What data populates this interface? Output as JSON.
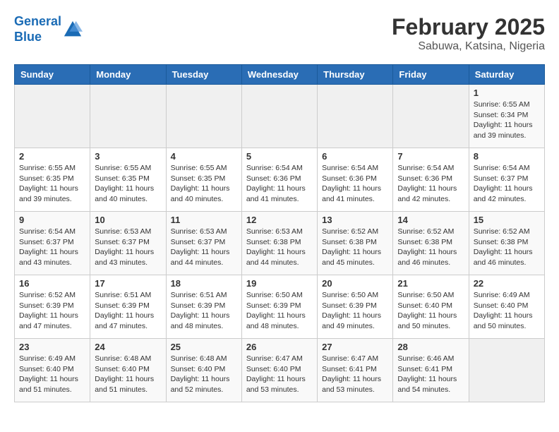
{
  "header": {
    "logo_line1": "General",
    "logo_line2": "Blue",
    "title": "February 2025",
    "subtitle": "Sabuwa, Katsina, Nigeria"
  },
  "weekdays": [
    "Sunday",
    "Monday",
    "Tuesday",
    "Wednesday",
    "Thursday",
    "Friday",
    "Saturday"
  ],
  "weeks": [
    [
      {
        "day": "",
        "info": ""
      },
      {
        "day": "",
        "info": ""
      },
      {
        "day": "",
        "info": ""
      },
      {
        "day": "",
        "info": ""
      },
      {
        "day": "",
        "info": ""
      },
      {
        "day": "",
        "info": ""
      },
      {
        "day": "1",
        "info": "Sunrise: 6:55 AM\nSunset: 6:34 PM\nDaylight: 11 hours\nand 39 minutes."
      }
    ],
    [
      {
        "day": "2",
        "info": "Sunrise: 6:55 AM\nSunset: 6:35 PM\nDaylight: 11 hours\nand 39 minutes."
      },
      {
        "day": "3",
        "info": "Sunrise: 6:55 AM\nSunset: 6:35 PM\nDaylight: 11 hours\nand 40 minutes."
      },
      {
        "day": "4",
        "info": "Sunrise: 6:55 AM\nSunset: 6:35 PM\nDaylight: 11 hours\nand 40 minutes."
      },
      {
        "day": "5",
        "info": "Sunrise: 6:54 AM\nSunset: 6:36 PM\nDaylight: 11 hours\nand 41 minutes."
      },
      {
        "day": "6",
        "info": "Sunrise: 6:54 AM\nSunset: 6:36 PM\nDaylight: 11 hours\nand 41 minutes."
      },
      {
        "day": "7",
        "info": "Sunrise: 6:54 AM\nSunset: 6:36 PM\nDaylight: 11 hours\nand 42 minutes."
      },
      {
        "day": "8",
        "info": "Sunrise: 6:54 AM\nSunset: 6:37 PM\nDaylight: 11 hours\nand 42 minutes."
      }
    ],
    [
      {
        "day": "9",
        "info": "Sunrise: 6:54 AM\nSunset: 6:37 PM\nDaylight: 11 hours\nand 43 minutes."
      },
      {
        "day": "10",
        "info": "Sunrise: 6:53 AM\nSunset: 6:37 PM\nDaylight: 11 hours\nand 43 minutes."
      },
      {
        "day": "11",
        "info": "Sunrise: 6:53 AM\nSunset: 6:37 PM\nDaylight: 11 hours\nand 44 minutes."
      },
      {
        "day": "12",
        "info": "Sunrise: 6:53 AM\nSunset: 6:38 PM\nDaylight: 11 hours\nand 44 minutes."
      },
      {
        "day": "13",
        "info": "Sunrise: 6:52 AM\nSunset: 6:38 PM\nDaylight: 11 hours\nand 45 minutes."
      },
      {
        "day": "14",
        "info": "Sunrise: 6:52 AM\nSunset: 6:38 PM\nDaylight: 11 hours\nand 46 minutes."
      },
      {
        "day": "15",
        "info": "Sunrise: 6:52 AM\nSunset: 6:38 PM\nDaylight: 11 hours\nand 46 minutes."
      }
    ],
    [
      {
        "day": "16",
        "info": "Sunrise: 6:52 AM\nSunset: 6:39 PM\nDaylight: 11 hours\nand 47 minutes."
      },
      {
        "day": "17",
        "info": "Sunrise: 6:51 AM\nSunset: 6:39 PM\nDaylight: 11 hours\nand 47 minutes."
      },
      {
        "day": "18",
        "info": "Sunrise: 6:51 AM\nSunset: 6:39 PM\nDaylight: 11 hours\nand 48 minutes."
      },
      {
        "day": "19",
        "info": "Sunrise: 6:50 AM\nSunset: 6:39 PM\nDaylight: 11 hours\nand 48 minutes."
      },
      {
        "day": "20",
        "info": "Sunrise: 6:50 AM\nSunset: 6:39 PM\nDaylight: 11 hours\nand 49 minutes."
      },
      {
        "day": "21",
        "info": "Sunrise: 6:50 AM\nSunset: 6:40 PM\nDaylight: 11 hours\nand 50 minutes."
      },
      {
        "day": "22",
        "info": "Sunrise: 6:49 AM\nSunset: 6:40 PM\nDaylight: 11 hours\nand 50 minutes."
      }
    ],
    [
      {
        "day": "23",
        "info": "Sunrise: 6:49 AM\nSunset: 6:40 PM\nDaylight: 11 hours\nand 51 minutes."
      },
      {
        "day": "24",
        "info": "Sunrise: 6:48 AM\nSunset: 6:40 PM\nDaylight: 11 hours\nand 51 minutes."
      },
      {
        "day": "25",
        "info": "Sunrise: 6:48 AM\nSunset: 6:40 PM\nDaylight: 11 hours\nand 52 minutes."
      },
      {
        "day": "26",
        "info": "Sunrise: 6:47 AM\nSunset: 6:40 PM\nDaylight: 11 hours\nand 53 minutes."
      },
      {
        "day": "27",
        "info": "Sunrise: 6:47 AM\nSunset: 6:41 PM\nDaylight: 11 hours\nand 53 minutes."
      },
      {
        "day": "28",
        "info": "Sunrise: 6:46 AM\nSunset: 6:41 PM\nDaylight: 11 hours\nand 54 minutes."
      },
      {
        "day": "",
        "info": ""
      }
    ]
  ]
}
